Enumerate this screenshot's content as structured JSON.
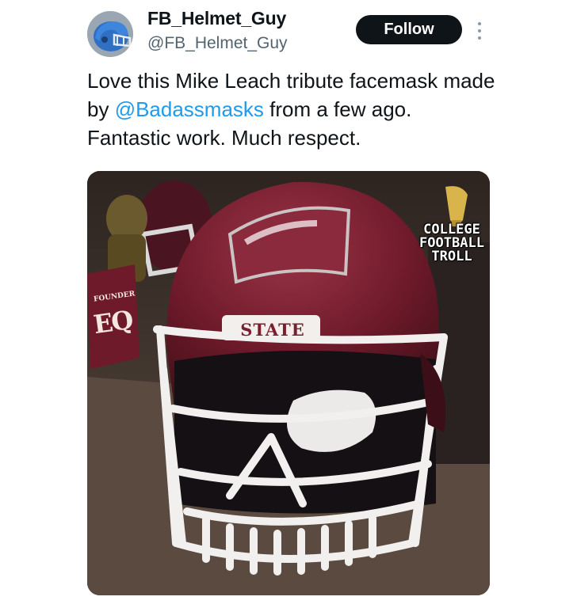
{
  "user": {
    "display_name": "FB_Helmet_Guy",
    "handle": "@FB_Helmet_Guy",
    "avatar_icon": "helmet-avatar-icon"
  },
  "actions": {
    "follow_label": "Follow",
    "more_icon": "more-vertical-icon"
  },
  "tweet": {
    "text_before": "Love this Mike Leach tribute facemask made by ",
    "mention": "@Badassmasks",
    "text_after": " from a few ago. Fantastic work. Much respect."
  },
  "media": {
    "description_icon": "helmet-photo",
    "watermark_lines": [
      "COLLEGE",
      "FOOTBALL",
      "TROLL"
    ],
    "helmet_stripe_text": "STATE",
    "sign_small_text": "FOUNDER",
    "sign_big_text": "EQ"
  },
  "colors": {
    "follow_bg": "#0f1419",
    "mention": "#1d9bf0",
    "handle": "#536471",
    "helmet_maroon": "#6e1a2a"
  }
}
